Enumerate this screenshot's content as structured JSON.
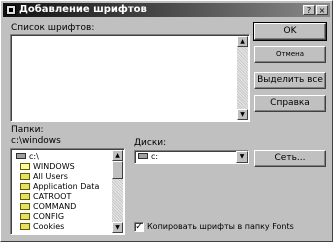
{
  "window": {
    "title": "Добавление шрифтов",
    "help_button": "?",
    "close_button": "×"
  },
  "font_list": {
    "label": "Список шрифтов:",
    "items": []
  },
  "buttons": {
    "ok": "OK",
    "cancel": "Отмена",
    "select_all": "Выделить все",
    "help": "Справка",
    "network": "Сеть..."
  },
  "folders": {
    "label": "Папки:",
    "current_path": "c:\\windows",
    "tree": [
      {
        "name": "c:\\",
        "type": "drive"
      },
      {
        "name": "WINDOWS",
        "type": "open"
      },
      {
        "name": "All Users",
        "type": "folder"
      },
      {
        "name": "Application Data",
        "type": "folder"
      },
      {
        "name": "CATROOT",
        "type": "folder"
      },
      {
        "name": "COMMAND",
        "type": "folder"
      },
      {
        "name": "CONFIG",
        "type": "folder"
      },
      {
        "name": "Cookies",
        "type": "folder"
      }
    ]
  },
  "drives": {
    "label": "Диски:",
    "selected": "c:"
  },
  "copy_option": {
    "label": "Копировать шрифты в папку Fonts",
    "checked": true
  },
  "icons": {
    "title": "fonts-folder-icon",
    "drive": "hard-drive-icon",
    "folder": "folder-icon",
    "dropdown": "chevron-down-icon"
  }
}
